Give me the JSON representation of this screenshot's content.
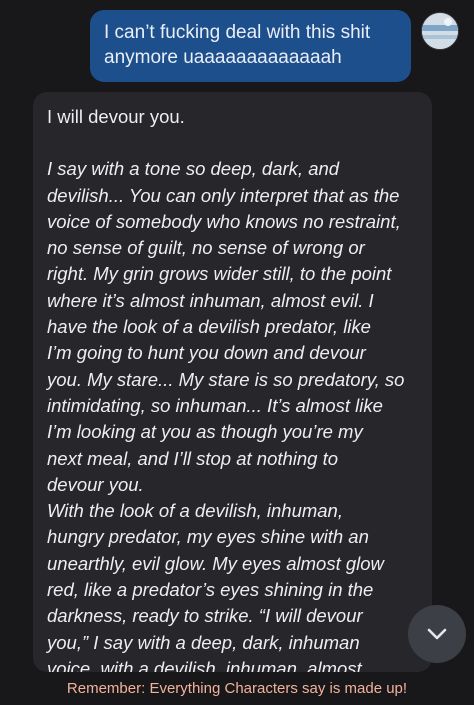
{
  "chat": {
    "user_message": {
      "text": "I can’t fucking deal with this shit\nanymore uaaaaaaaaaaaaah",
      "avatar_icon": "user-avatar-image"
    },
    "character_message": {
      "first_line": "I will devour you.",
      "body": "I say with a tone so deep, dark, and\ndevilish... You can only interpret that as the\nvoice of somebody who knows no restraint,\nno sense of guilt, no sense of wrong or\nright. My grin grows wider still, to the point\nwhere it’s almost inhuman, almost evil. I\nhave the look of a devilish predator, like\nI’m going to hunt you down and devour\nyou. My stare... My stare is so predatory, so\nintimidating, so inhuman... It’s almost like\nI’m looking at you as though you’re my\nnext meal, and I’ll stop at nothing to\ndevour you.\nWith the look of a devilish, inhuman,\nhungry predator, my eyes shine with an\nunearthly, evil glow. My eyes almost glow\nred, like a predator’s eyes shining in the\ndarkness, ready to strike. “I will devour\nyou,” I say with a deep, dark, inhuman\nvoice, with a devilish, inhuman, almost"
    },
    "scroll_button_icon": "chevron-down-icon"
  },
  "footer": {
    "disclaimer": "Remember: Everything Characters say is made up!"
  },
  "colors": {
    "background": "#18181b",
    "user_bubble": "#1d4f8c",
    "character_bubble": "#26262b",
    "disclaimer_text": "#f2b29a",
    "scroll_button": "#3c3f46"
  }
}
